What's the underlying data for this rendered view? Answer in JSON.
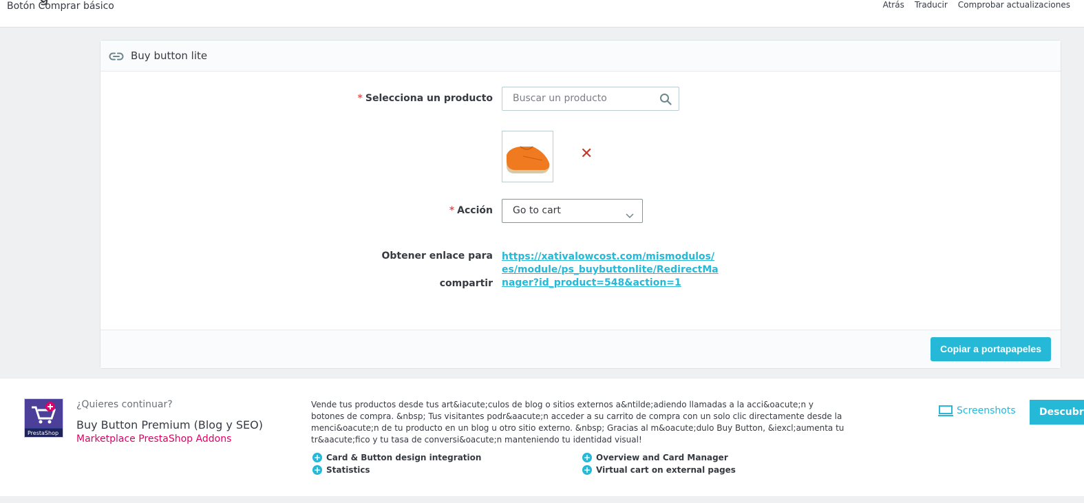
{
  "header": {
    "title_fragment": "g",
    "subtitle": "Botón Comprar básico",
    "toolbar": {
      "back": "Atrás",
      "translate": "Traducir",
      "check_updates": "Comprobar actualizaciones"
    }
  },
  "panel": {
    "title": "Buy button lite",
    "product_label": "Selecciona un producto",
    "search_placeholder": "Buscar un producto",
    "remove_symbol": "✕",
    "action_label": "Acción",
    "action_value": "Go to cart",
    "share_label_line1": "Obtener enlace para",
    "share_label_line2": "compartir",
    "share_url": "https://xativalowcost.com/mismodulos/es/module/ps_buybuttonlite/RedirectManager?id_product=548&action=1",
    "copy_button": "Copiar a portapapeles",
    "required_mark": "*"
  },
  "addon": {
    "question": "¿Quieres continuar?",
    "name": "Buy Button Premium (Blog y SEO)",
    "marketplace": "Marketplace PrestaShop Addons",
    "logo_text": "PrestaShop",
    "description": "Vende tus productos desde tus art&iacute;culos de blog o sitios externos a&ntilde;adiendo llamadas a la acci&oacute;n y botones de compra. &nbsp; Tus visitantes podr&aacute;n acceder a su carrito de compra con un solo clic directamente desde la menci&oacute;n de tu producto en un blog u otro sitio externo. &nbsp; Gracias al m&oacute;dulo Buy Button, &iexcl;aumenta tu tr&aacute;fico y tu tasa de conversi&oacute;n manteniendo tu identidad visual!",
    "features": [
      "Card & Button design integration",
      "Statistics",
      "Overview and Card Manager",
      "Virtual cart on external pages"
    ],
    "screenshots": "Screenshots",
    "discover": "Descubrir"
  },
  "colors": {
    "accent": "#25b9d7",
    "required": "#e25858",
    "marketplace": "#df0067"
  }
}
